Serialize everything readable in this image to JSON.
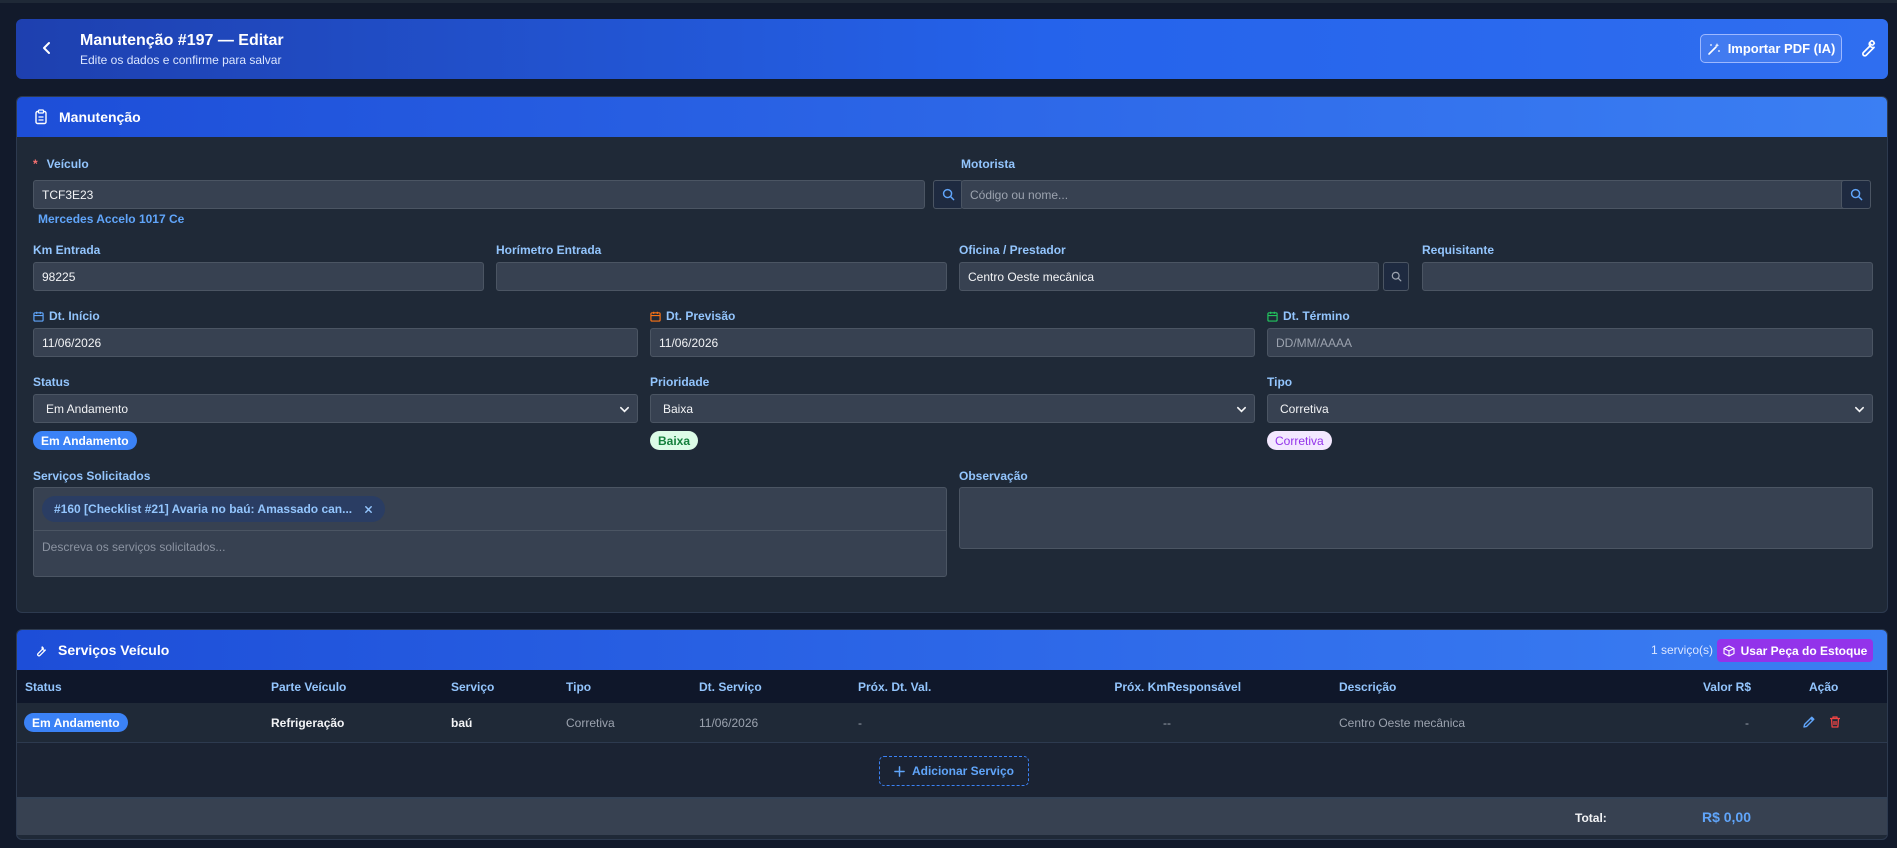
{
  "header": {
    "title": "Manutenção #197 — Editar",
    "subtitle": "Edite os dados e confirme para salvar",
    "import_label": "Importar PDF (IA)"
  },
  "maint": {
    "section_title": "Manutenção",
    "veiculo_label": "Veículo",
    "veiculo_value": "TCF3E23",
    "veiculo_model": "Mercedes Accelo 1017 Ce",
    "motorista_label": "Motorista",
    "motorista_placeholder": "Código ou nome...",
    "km_label": "Km Entrada",
    "km_value": "98225",
    "horimetro_label": "Horímetro Entrada",
    "horimetro_value": "",
    "oficina_label": "Oficina / Prestador",
    "oficina_value": "Centro Oeste mecânica",
    "requisitante_label": "Requisitante",
    "requisitante_value": "",
    "dt_inicio_label": "Dt. Início",
    "dt_inicio_value": "11/06/2026",
    "dt_previsao_label": "Dt. Previsão",
    "dt_previsao_value": "11/06/2026",
    "dt_termino_label": "Dt. Término",
    "dt_termino_placeholder": "DD/MM/AAAA",
    "status_label": "Status",
    "status_value": "Em Andamento",
    "status_badge": "Em Andamento",
    "prioridade_label": "Prioridade",
    "prioridade_value": "Baixa",
    "prioridade_badge": "Baixa",
    "tipo_label": "Tipo",
    "tipo_value": "Corretiva",
    "tipo_badge": "Corretiva",
    "servicos_label": "Serviços Solicitados",
    "servicos_chip": "#160 [Checklist #21] Avaria no baú: Amassado can...",
    "servicos_placeholder": "Descreva os serviços solicitados...",
    "observacao_label": "Observação",
    "observacao_value": ""
  },
  "services": {
    "section_title": "Serviços Veículo",
    "count_text": "1 serviço(s)",
    "stock_button": "Usar Peça do Estoque",
    "columns": {
      "status": "Status",
      "parte": "Parte Veículo",
      "servico": "Serviço",
      "tipo": "Tipo",
      "dt_servico": "Dt. Serviço",
      "prox_dt": "Próx. Dt. Val.",
      "prox_km": "Próx. Km",
      "responsavel": "Responsável",
      "descricao": "Descrição",
      "valor": "Valor R$",
      "acao": "Ação"
    },
    "rows": [
      {
        "status": "Em Andamento",
        "parte": "Refrigeração",
        "servico": "baú",
        "tipo": "Corretiva",
        "dt_servico": "11/06/2026",
        "prox_dt": "-",
        "prox_km": "-",
        "responsavel": "-",
        "descricao": "Centro Oeste mecânica",
        "valor": "-"
      }
    ],
    "add_label": "Adicionar Serviço",
    "total_label": "Total:",
    "total_value": "R$ 0,00"
  },
  "colors": {
    "accent": "#2563eb",
    "status_blue": "#3b82f6",
    "priority_green": "#dcfce7",
    "type_purple": "#f3e8ff",
    "stock_purple": "#9333ea",
    "delete_red": "#ef4444"
  },
  "icons": [
    "chevron-left-icon",
    "magic-wand-icon",
    "wrench-icon",
    "clipboard-icon",
    "search-icon",
    "calendar-icon",
    "chevron-down-icon",
    "close-icon",
    "package-icon",
    "plus-icon",
    "pencil-icon",
    "trash-icon"
  ]
}
